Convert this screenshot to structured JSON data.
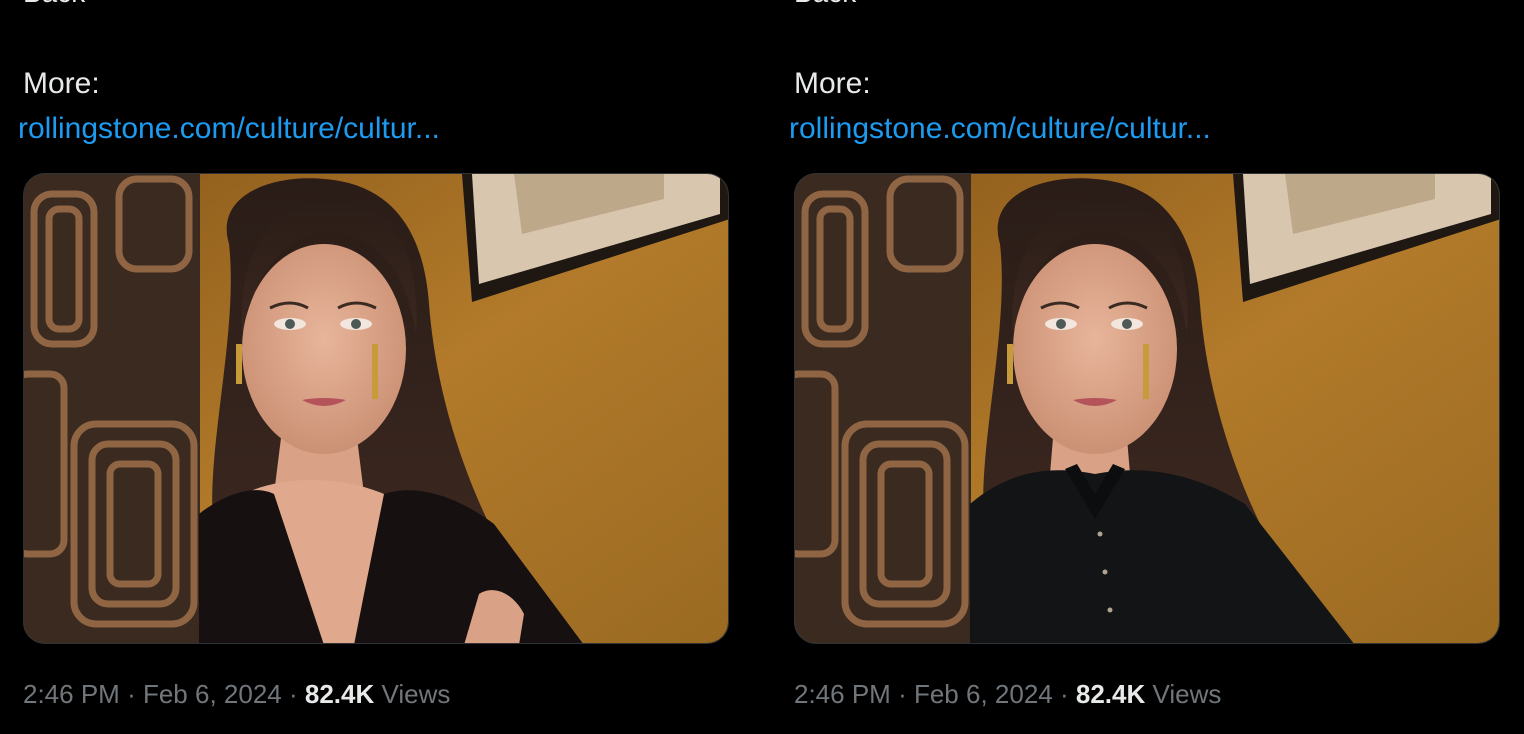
{
  "tweets": [
    {
      "cut_text": "Back",
      "more_label": "More:",
      "link_text": "rollingstone.com/culture/cultur...",
      "image": {
        "description_alt": "photo",
        "variant": "original"
      },
      "time": "2:46 PM",
      "date": "Feb 6, 2024",
      "separator": "·",
      "views_count": "82.4K",
      "views_label": "Views"
    },
    {
      "cut_text": "Back",
      "more_label": "More:",
      "link_text": "rollingstone.com/culture/cultur...",
      "image": {
        "description_alt": "photo",
        "variant": "edited"
      },
      "time": "2:46 PM",
      "date": "Feb 6, 2024",
      "separator": "·",
      "views_count": "82.4K",
      "views_label": "Views"
    }
  ],
  "colors": {
    "background": "#000000",
    "text_primary": "#e7e9ea",
    "text_secondary": "#71767b",
    "link": "#1d9bf0",
    "media_border": "#2f3336"
  }
}
